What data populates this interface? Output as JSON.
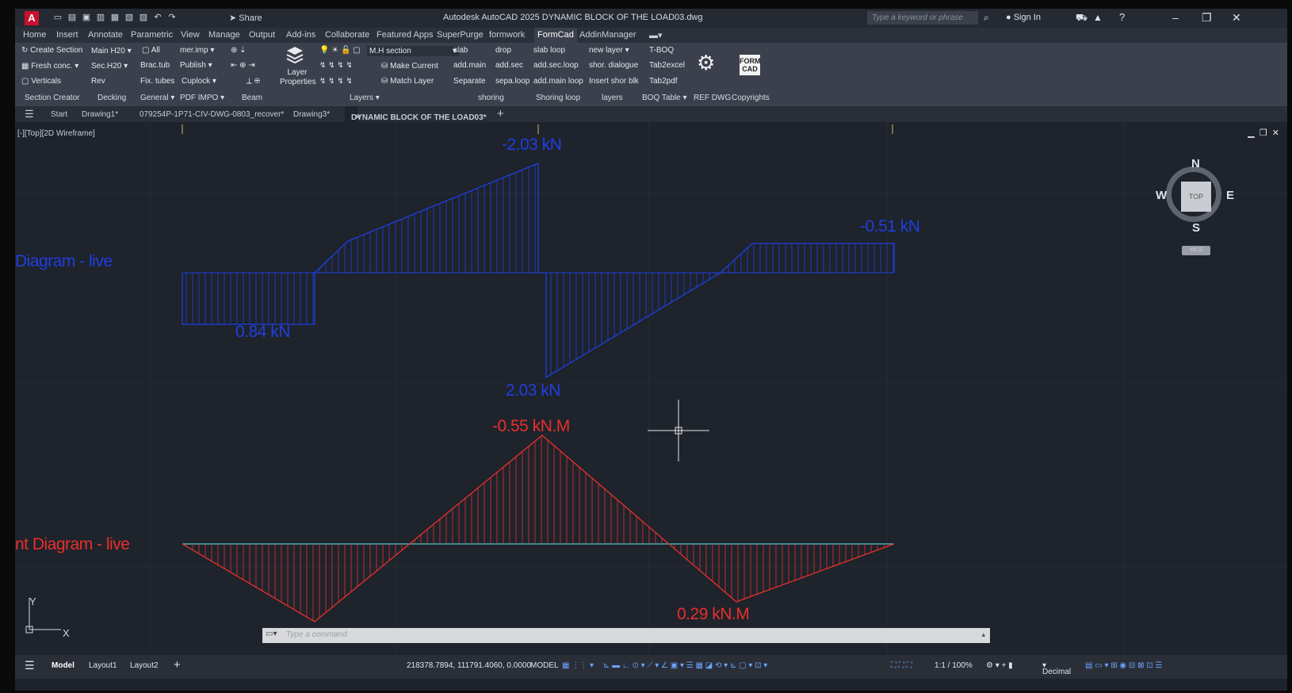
{
  "title_bar": {
    "share": "Share",
    "window_title": "Autodesk AutoCAD 2025   DYNAMIC BLOCK OF THE LOAD03.dwg",
    "search_placeholder": "Type a keyword or phrase",
    "sign_in": "Sign In"
  },
  "ribbon_tabs": [
    "Home",
    "Insert",
    "Annotate",
    "Parametric",
    "View",
    "Manage",
    "Output",
    "Add-ins",
    "Collaborate",
    "Featured Apps",
    "SuperPurge",
    "formwork",
    "FormCad",
    "AddinManager"
  ],
  "ribbon_active_tab": "FormCad",
  "ribbon": {
    "create_section": "Create Section",
    "fresh_conc": "Fresh conc.",
    "verticals": "Verticals",
    "main_h20": "Main H20",
    "sec_h20": "Sec.H20",
    "rev": "Rev",
    "all": "All",
    "brac_tub": "Brac.tub",
    "fix_tubes": "Fix. tubes",
    "mer_imp": "mer.imp",
    "publish": "Publish",
    "cuplock": "Cuplock",
    "layer_properties": "Layer Properties",
    "layer_current": "M.H section",
    "make_current": "Make Current",
    "match_layer": "Match Layer",
    "slab": "slab",
    "drop": "drop",
    "add_main": "add.main",
    "add_sec": "add.sec",
    "separate": "Separate",
    "sepa_loop": "sepa.loop",
    "slab_loop": "slab loop",
    "add_sec_loop": "add.sec.loop",
    "add_main_loop": "add.main loop",
    "new_layer": "new layer",
    "shor_dialogue": "shor. dialogue",
    "insert_shor_blk": "Insert shor blk",
    "t_boq": "T-BOQ",
    "tab2excel": "Tab2excel",
    "tab2pdf": "Tab2pdf",
    "formcad_logo": "FORM CAD",
    "panels": {
      "section_creator": "Section Creator",
      "decking": "Decking",
      "general": "General",
      "pdf_impo": "PDF IMPO",
      "beam": "Beam",
      "layers": "Layers",
      "shoring": "shoring",
      "shoring_loop": "Shoring loop",
      "layers2": "layers",
      "boq_table": "BOQ Table",
      "ref_dwg": "REF DWG",
      "copyrights": "Copyrights"
    }
  },
  "doc_tabs": [
    "Start",
    "Drawing1*",
    "079254P-1P71-CIV-DWG-0803_recover*",
    "Drawing3*",
    "DYNAMIC BLOCK OF THE LOAD03*"
  ],
  "viewport": {
    "label": "[-][Top][2D Wireframe]",
    "shear_title": "Diagram - live",
    "moment_title": "nt Diagram - live",
    "shear_labels": {
      "top": "-2.03 kN",
      "right": "-0.51 kN",
      "left": "0.84 kN",
      "bottom": "2.03 kN"
    },
    "moment_labels": {
      "top": "-0.55 kN.M",
      "bottom": "0.29 kN.M"
    },
    "viewcube": {
      "n": "N",
      "s": "S",
      "e": "E",
      "w": "W",
      "top": "TOP",
      "wcs": "WCS"
    },
    "ucs": {
      "x": "X",
      "y": "Y"
    },
    "shear_color": "#1f3fe0",
    "moment_color": "#e8302a"
  },
  "command": {
    "placeholder": "Type a command"
  },
  "status_bar": {
    "tabs": [
      "Model",
      "Layout1",
      "Layout2"
    ],
    "coords": "218378.7894, 111791.4060, 0.0000",
    "model": "MODEL",
    "scale": "1:1 / 100%",
    "units": "Decimal"
  }
}
